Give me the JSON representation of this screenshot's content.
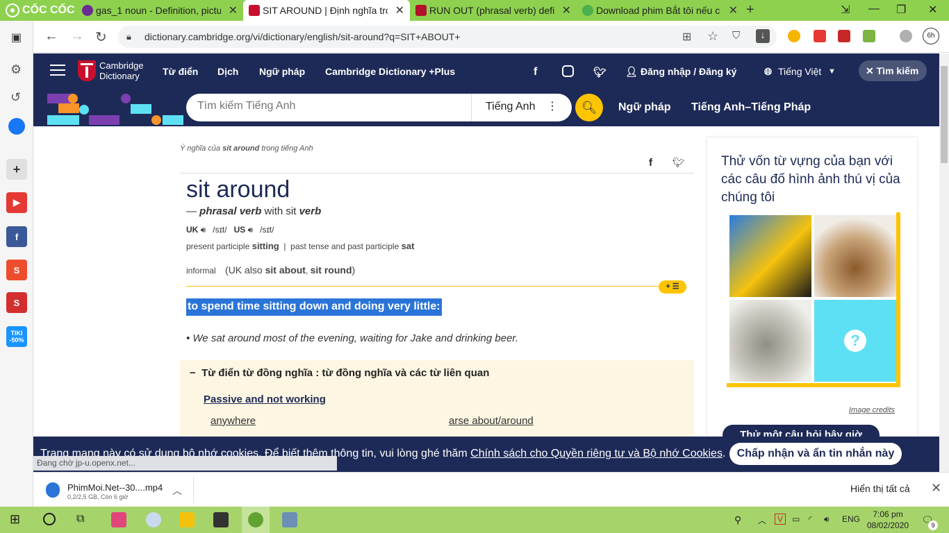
{
  "browser": {
    "brand": "CỐC CỐC",
    "tabs": [
      {
        "title": "gas_1 noun - Definition, pictu"
      },
      {
        "title": "SIT AROUND | Định nghĩa tro"
      },
      {
        "title": "RUN OUT (phrasal verb) defin"
      },
      {
        "title": "Download phim Bắt tôi nếu c"
      }
    ],
    "url": "dictionary.cambridge.org/vi/dictionary/english/sit-around?q=SIT+ABOUT+",
    "profile_badge": "6h"
  },
  "sidebar": {
    "tiki_label": "TIKI -50%"
  },
  "site": {
    "logo_line1": "Cambridge",
    "logo_line2": "Dictionary",
    "nav": [
      "Từ điển",
      "Dịch",
      "Ngữ pháp",
      "Cambridge Dictionary +Plus"
    ],
    "login": "Đăng nhập / Đăng ký",
    "language": "Tiếng Việt",
    "search_button": "Tìm kiếm",
    "search_placeholder": "Tìm kiếm Tiếng Anh",
    "search_lang": "Tiếng Anh",
    "nav2": [
      "Ngữ pháp",
      "Tiếng Anh–Tiếng Pháp"
    ]
  },
  "entry": {
    "crumb_pre": "Ý nghĩa của ",
    "crumb_word": "sit around",
    "crumb_post": " trong tiếng Anh",
    "headword": "sit around",
    "pos_dash": "— ",
    "pos": "phrasal verb",
    "pos_with": " with sit ",
    "pos_verb": "verb",
    "uk": "UK",
    "uk_ipa": "/sɪt/",
    "us": "US",
    "us_ipa": "/sɪt/",
    "present_participle_label": "present participle ",
    "present_participle": "sitting",
    "past_label": "past tense and past participle ",
    "past": "sat",
    "register": "informal",
    "also_pre": "(UK also ",
    "also_1": "sit about",
    "also_sep": ", ",
    "also_2": "sit round",
    "also_post": ")",
    "badge": "+ ☰",
    "definition": "to spend time sitting down and doing very little:",
    "example": "We sat around most of the evening, waiting for Jake and drinking beer.",
    "thesaurus_heading": "Từ điển từ đồng nghĩa : từ đồng nghĩa và các từ liên quan",
    "thesaurus_sub": "Passive and not working",
    "thesaurus_words": [
      "anywhere",
      "arse about/around"
    ]
  },
  "quiz_panel": {
    "title": "Thử vốn từ vựng của bạn với các câu đố hình ảnh thú vị của chúng tôi",
    "credits": "Image credits",
    "button": "Thử một câu hỏi bây giờ"
  },
  "cookie": {
    "text": "Trang mạng này có sử dụng bộ nhớ cookies. Để biết thêm thông tin, vui lòng ghé thăm ",
    "link": "Chính sách cho Quyền riêng tư và Bộ nhớ Cookies",
    "tail": ".",
    "accept": "Chấp nhận và ẩn tin nhắn này"
  },
  "status": "Đang chờ jp-u.openx.net...",
  "download": {
    "filename": "PhimMoi.Net--30....mp4",
    "progress": "0,2/2,5 GB, Còn 6 giờ",
    "show_all": "Hiển thị tất cả"
  },
  "taskbar": {
    "lang": "ENG",
    "time": "7:06 pm",
    "date": "08/02/2020",
    "notif": "9"
  },
  "colors": {
    "navy": "#1d2a57",
    "yellow": "#fec400",
    "highlight": "#2a74d8",
    "browser_green": "#8ed14f"
  }
}
